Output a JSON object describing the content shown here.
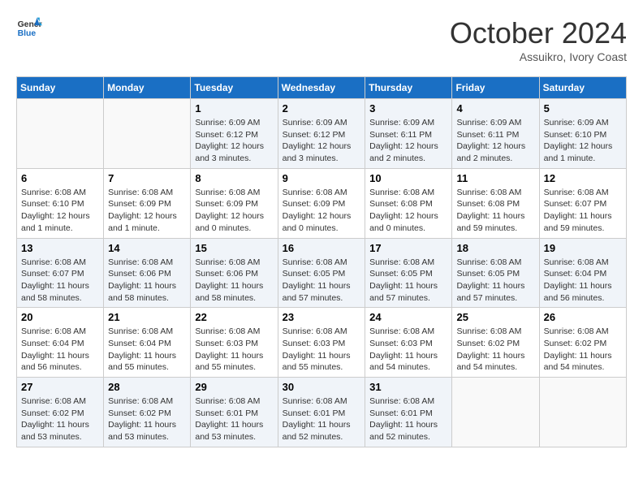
{
  "logo": {
    "text_general": "General",
    "text_blue": "Blue"
  },
  "header": {
    "month": "October 2024",
    "location": "Assuikro, Ivory Coast"
  },
  "weekdays": [
    "Sunday",
    "Monday",
    "Tuesday",
    "Wednesday",
    "Thursday",
    "Friday",
    "Saturday"
  ],
  "weeks": [
    [
      {
        "day": "",
        "info": ""
      },
      {
        "day": "",
        "info": ""
      },
      {
        "day": "1",
        "info": "Sunrise: 6:09 AM\nSunset: 6:12 PM\nDaylight: 12 hours and 3 minutes."
      },
      {
        "day": "2",
        "info": "Sunrise: 6:09 AM\nSunset: 6:12 PM\nDaylight: 12 hours and 3 minutes."
      },
      {
        "day": "3",
        "info": "Sunrise: 6:09 AM\nSunset: 6:11 PM\nDaylight: 12 hours and 2 minutes."
      },
      {
        "day": "4",
        "info": "Sunrise: 6:09 AM\nSunset: 6:11 PM\nDaylight: 12 hours and 2 minutes."
      },
      {
        "day": "5",
        "info": "Sunrise: 6:09 AM\nSunset: 6:10 PM\nDaylight: 12 hours and 1 minute."
      }
    ],
    [
      {
        "day": "6",
        "info": "Sunrise: 6:08 AM\nSunset: 6:10 PM\nDaylight: 12 hours and 1 minute."
      },
      {
        "day": "7",
        "info": "Sunrise: 6:08 AM\nSunset: 6:09 PM\nDaylight: 12 hours and 1 minute."
      },
      {
        "day": "8",
        "info": "Sunrise: 6:08 AM\nSunset: 6:09 PM\nDaylight: 12 hours and 0 minutes."
      },
      {
        "day": "9",
        "info": "Sunrise: 6:08 AM\nSunset: 6:09 PM\nDaylight: 12 hours and 0 minutes."
      },
      {
        "day": "10",
        "info": "Sunrise: 6:08 AM\nSunset: 6:08 PM\nDaylight: 12 hours and 0 minutes."
      },
      {
        "day": "11",
        "info": "Sunrise: 6:08 AM\nSunset: 6:08 PM\nDaylight: 11 hours and 59 minutes."
      },
      {
        "day": "12",
        "info": "Sunrise: 6:08 AM\nSunset: 6:07 PM\nDaylight: 11 hours and 59 minutes."
      }
    ],
    [
      {
        "day": "13",
        "info": "Sunrise: 6:08 AM\nSunset: 6:07 PM\nDaylight: 11 hours and 58 minutes."
      },
      {
        "day": "14",
        "info": "Sunrise: 6:08 AM\nSunset: 6:06 PM\nDaylight: 11 hours and 58 minutes."
      },
      {
        "day": "15",
        "info": "Sunrise: 6:08 AM\nSunset: 6:06 PM\nDaylight: 11 hours and 58 minutes."
      },
      {
        "day": "16",
        "info": "Sunrise: 6:08 AM\nSunset: 6:05 PM\nDaylight: 11 hours and 57 minutes."
      },
      {
        "day": "17",
        "info": "Sunrise: 6:08 AM\nSunset: 6:05 PM\nDaylight: 11 hours and 57 minutes."
      },
      {
        "day": "18",
        "info": "Sunrise: 6:08 AM\nSunset: 6:05 PM\nDaylight: 11 hours and 57 minutes."
      },
      {
        "day": "19",
        "info": "Sunrise: 6:08 AM\nSunset: 6:04 PM\nDaylight: 11 hours and 56 minutes."
      }
    ],
    [
      {
        "day": "20",
        "info": "Sunrise: 6:08 AM\nSunset: 6:04 PM\nDaylight: 11 hours and 56 minutes."
      },
      {
        "day": "21",
        "info": "Sunrise: 6:08 AM\nSunset: 6:04 PM\nDaylight: 11 hours and 55 minutes."
      },
      {
        "day": "22",
        "info": "Sunrise: 6:08 AM\nSunset: 6:03 PM\nDaylight: 11 hours and 55 minutes."
      },
      {
        "day": "23",
        "info": "Sunrise: 6:08 AM\nSunset: 6:03 PM\nDaylight: 11 hours and 55 minutes."
      },
      {
        "day": "24",
        "info": "Sunrise: 6:08 AM\nSunset: 6:03 PM\nDaylight: 11 hours and 54 minutes."
      },
      {
        "day": "25",
        "info": "Sunrise: 6:08 AM\nSunset: 6:02 PM\nDaylight: 11 hours and 54 minutes."
      },
      {
        "day": "26",
        "info": "Sunrise: 6:08 AM\nSunset: 6:02 PM\nDaylight: 11 hours and 54 minutes."
      }
    ],
    [
      {
        "day": "27",
        "info": "Sunrise: 6:08 AM\nSunset: 6:02 PM\nDaylight: 11 hours and 53 minutes."
      },
      {
        "day": "28",
        "info": "Sunrise: 6:08 AM\nSunset: 6:02 PM\nDaylight: 11 hours and 53 minutes."
      },
      {
        "day": "29",
        "info": "Sunrise: 6:08 AM\nSunset: 6:01 PM\nDaylight: 11 hours and 53 minutes."
      },
      {
        "day": "30",
        "info": "Sunrise: 6:08 AM\nSunset: 6:01 PM\nDaylight: 11 hours and 52 minutes."
      },
      {
        "day": "31",
        "info": "Sunrise: 6:08 AM\nSunset: 6:01 PM\nDaylight: 11 hours and 52 minutes."
      },
      {
        "day": "",
        "info": ""
      },
      {
        "day": "",
        "info": ""
      }
    ]
  ]
}
